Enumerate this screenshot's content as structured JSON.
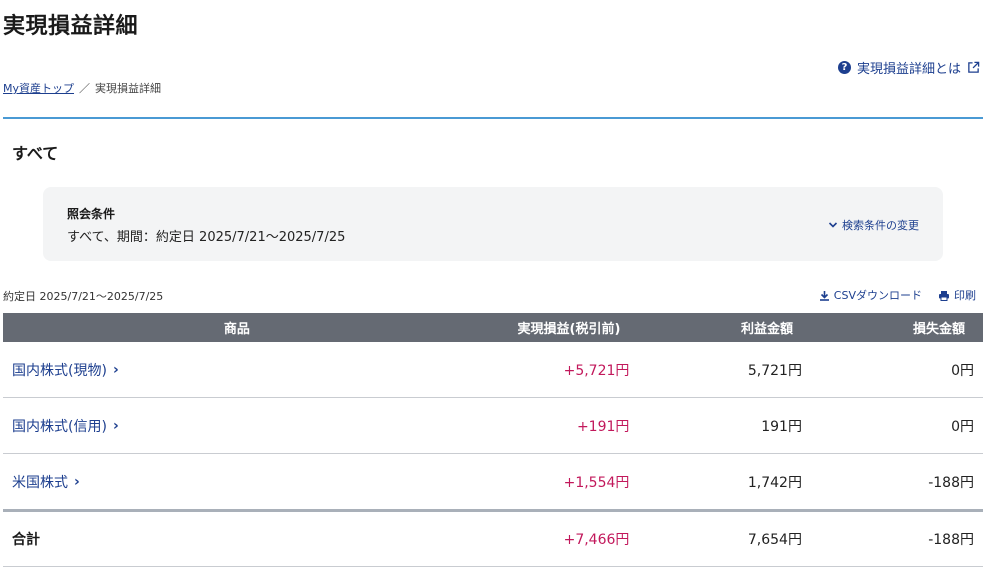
{
  "page": {
    "title": "実現損益詳細",
    "help_link": "実現損益詳細とは",
    "breadcrumb": {
      "home": "My資産トップ",
      "separator": "／",
      "current": "実現損益詳細"
    },
    "section_title": "すべて"
  },
  "conditions": {
    "label": "照会条件",
    "value": "すべて、期間：約定日 2025/7/21〜2025/7/25",
    "change_label": "検索条件の変更"
  },
  "period_text": "約定日 2025/7/21〜2025/7/25",
  "tools": {
    "csv": "CSVダウンロード",
    "print": "印刷"
  },
  "table": {
    "headers": [
      "商品",
      "実現損益(税引前)",
      "利益金額",
      "損失金額"
    ],
    "rows": [
      {
        "name": "国内株式(現物)",
        "realized": "+5,721円",
        "profit": "5,721円",
        "loss": "0円"
      },
      {
        "name": "国内株式(信用)",
        "realized": "+191円",
        "profit": "191円",
        "loss": "0円"
      },
      {
        "name": "米国株式",
        "realized": "+1,554円",
        "profit": "1,742円",
        "loss": "-188円"
      }
    ],
    "total": {
      "name": "合計",
      "realized": "+7,466円",
      "profit": "7,654円",
      "loss": "-188円"
    }
  },
  "colors": {
    "accent": "#1d3f8f",
    "positive": "#c2185b",
    "header_bg": "#656a73",
    "rule": "#4a9ad4"
  },
  "icons": {
    "help": "question-circle-icon",
    "external": "external-link-icon",
    "chevron": "chevron-down-icon",
    "download": "download-icon",
    "print": "printer-icon",
    "row_arrow": "chevron-right-icon"
  }
}
